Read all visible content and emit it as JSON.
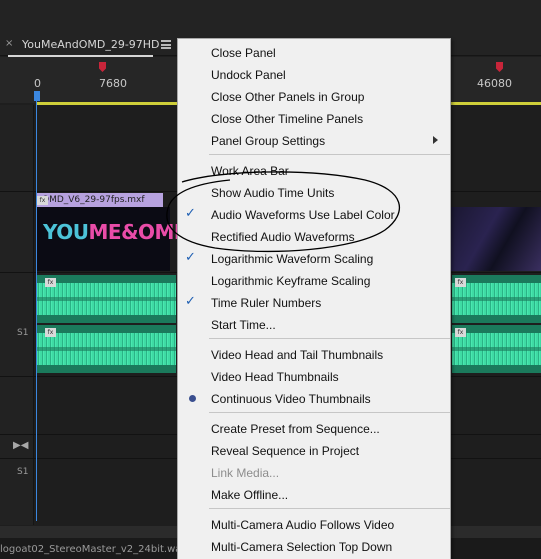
{
  "tab": {
    "close_glyph": "×",
    "title": "YouMeAndOMD_29-97HD",
    "menu_icon": "hamburger-menu-icon"
  },
  "ruler": {
    "labels": [
      "0",
      "7680",
      "46080"
    ]
  },
  "timeline": {
    "video_clip_name": "OMD_V6_29-97fps.mxf",
    "fx_label": "fx",
    "logo_text_a": "YOU",
    "logo_text_b": "ME&OMD",
    "track_labels": [
      "S1",
      "S1"
    ],
    "bottom_text": "logoat02_StereoMaster_v2_24bit.wa"
  },
  "menu": {
    "sections": [
      [
        {
          "label": "Close Panel",
          "state": "none",
          "disabled": false
        },
        {
          "label": "Undock Panel",
          "state": "none",
          "disabled": false
        },
        {
          "label": "Close Other Panels in Group",
          "state": "none",
          "disabled": false
        },
        {
          "label": "Close Other Timeline Panels",
          "state": "none",
          "disabled": false
        },
        {
          "label": "Panel Group Settings",
          "state": "none",
          "disabled": false,
          "submenu": true
        }
      ],
      [
        {
          "label": "Work Area Bar",
          "state": "none",
          "disabled": false
        },
        {
          "label": "Show Audio Time Units",
          "state": "none",
          "disabled": false
        },
        {
          "label": "Audio Waveforms Use Label Color",
          "state": "checked",
          "disabled": false
        },
        {
          "label": "Rectified Audio Waveforms",
          "state": "none",
          "disabled": false
        },
        {
          "label": "Logarithmic Waveform Scaling",
          "state": "checked",
          "disabled": false
        },
        {
          "label": "Logarithmic Keyframe Scaling",
          "state": "none",
          "disabled": false
        },
        {
          "label": "Time Ruler Numbers",
          "state": "checked",
          "disabled": false
        },
        {
          "label": "Start Time...",
          "state": "none",
          "disabled": false
        }
      ],
      [
        {
          "label": "Video Head and Tail Thumbnails",
          "state": "none",
          "disabled": false
        },
        {
          "label": "Video Head Thumbnails",
          "state": "none",
          "disabled": false
        },
        {
          "label": "Continuous Video Thumbnails",
          "state": "radio",
          "disabled": false
        }
      ],
      [
        {
          "label": "Create Preset from Sequence...",
          "state": "none",
          "disabled": false
        },
        {
          "label": "Reveal Sequence in Project",
          "state": "none",
          "disabled": false
        },
        {
          "label": "Link Media...",
          "state": "none",
          "disabled": true
        },
        {
          "label": "Make Offline...",
          "state": "none",
          "disabled": false
        }
      ],
      [
        {
          "label": "Multi-Camera Audio Follows Video",
          "state": "none",
          "disabled": false
        },
        {
          "label": "Multi-Camera Selection Top Down",
          "state": "none",
          "disabled": false
        }
      ]
    ]
  },
  "colors": {
    "menu_background": "#f0f0f0",
    "check_color": "#1f5fb3",
    "marker_red": "#c8253a",
    "playhead_blue": "#3b87e0",
    "audio_green": "#3fdba4",
    "video_label_purple": "#b7a2df",
    "work_area_yellow": "#cfcf3a"
  }
}
